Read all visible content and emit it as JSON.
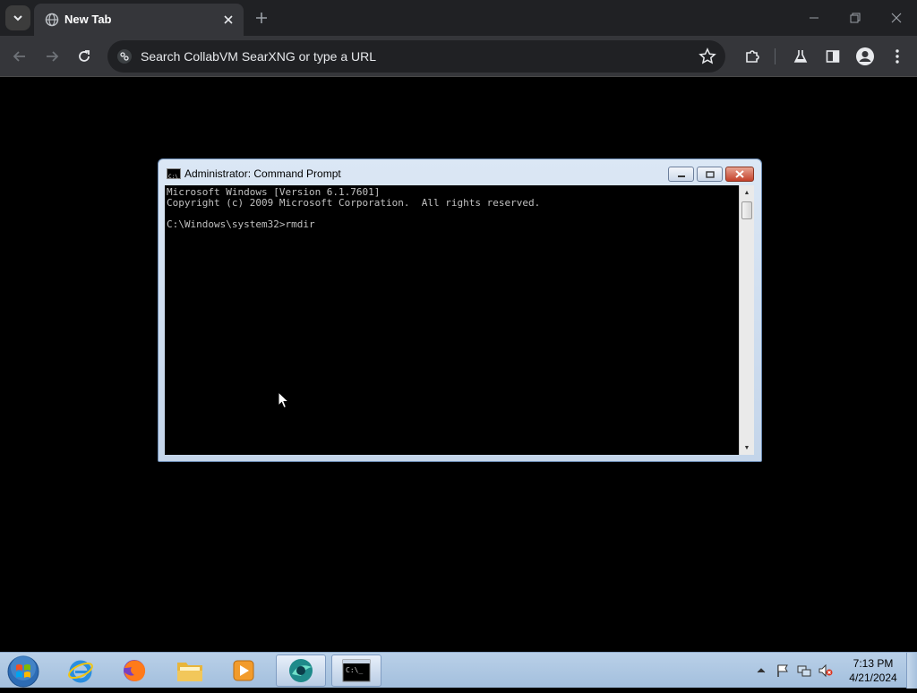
{
  "browser": {
    "tab_title": "New Tab",
    "omnibox_placeholder": "Search CollabVM SearXNG or type a URL",
    "icons": {
      "tab_list": "chevron-down-icon",
      "close_tab": "close-icon",
      "new_tab": "plus-icon",
      "back": "back-arrow-icon",
      "forward": "forward-arrow-icon",
      "reload": "reload-icon",
      "site_info": "tune-icon",
      "bookmark": "star-icon",
      "extensions": "puzzle-icon",
      "labs": "flask-icon",
      "side_panel": "side-panel-icon",
      "profile": "profile-icon",
      "menu": "kebab-menu-icon"
    }
  },
  "cmd": {
    "title": "Administrator:  Command Prompt",
    "lines": [
      "Microsoft Windows [Version 6.1.7601]",
      "Copyright (c) 2009 Microsoft Corporation.  All rights reserved.",
      "",
      "C:\\Windows\\system32>rmdir"
    ]
  },
  "taskbar": {
    "apps": [
      "internet-explorer",
      "firefox",
      "file-explorer",
      "media-player",
      "collabvm-browser",
      "command-prompt"
    ],
    "clock_time": "7:13 PM",
    "clock_date": "4/21/2024"
  },
  "colors": {
    "chrome_dark": "#202124",
    "toolbar": "#35363a",
    "console_bg": "#000000",
    "console_text": "#c0c0c0",
    "taskbar": "#a3bfdd"
  }
}
